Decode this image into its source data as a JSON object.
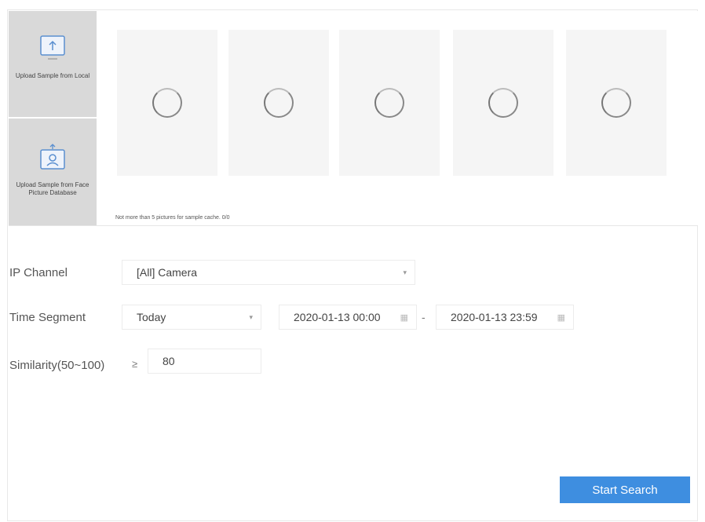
{
  "samples": {
    "upload_local_label": "Upload Sample from Local",
    "upload_db_label": "Upload Sample from Face Picture Database",
    "cache_note": "Not more than 5 pictures for sample cache. 0/0"
  },
  "form": {
    "ip_channel_label": "IP Channel",
    "ip_channel_value": "[All] Camera",
    "time_segment_label": "Time Segment",
    "time_segment_value": "Today",
    "start_time": "2020-01-13 00:00",
    "range_separator": "-",
    "end_time": "2020-01-13 23:59",
    "similarity_label": "Similarity(50~100)",
    "similarity_operator": "≥",
    "similarity_value": "80"
  },
  "actions": {
    "start_search_label": "Start Search"
  },
  "icons": {
    "upload_local": "upload-monitor-icon",
    "upload_db": "face-database-icon",
    "dropdown": "chevron-down-icon",
    "calendar": "calendar-icon",
    "loading": "loading-spinner-icon"
  },
  "colors": {
    "accent": "#3e8ee0",
    "sample_button_bg": "#d9d9d9",
    "slot_bg": "#f5f5f5"
  }
}
